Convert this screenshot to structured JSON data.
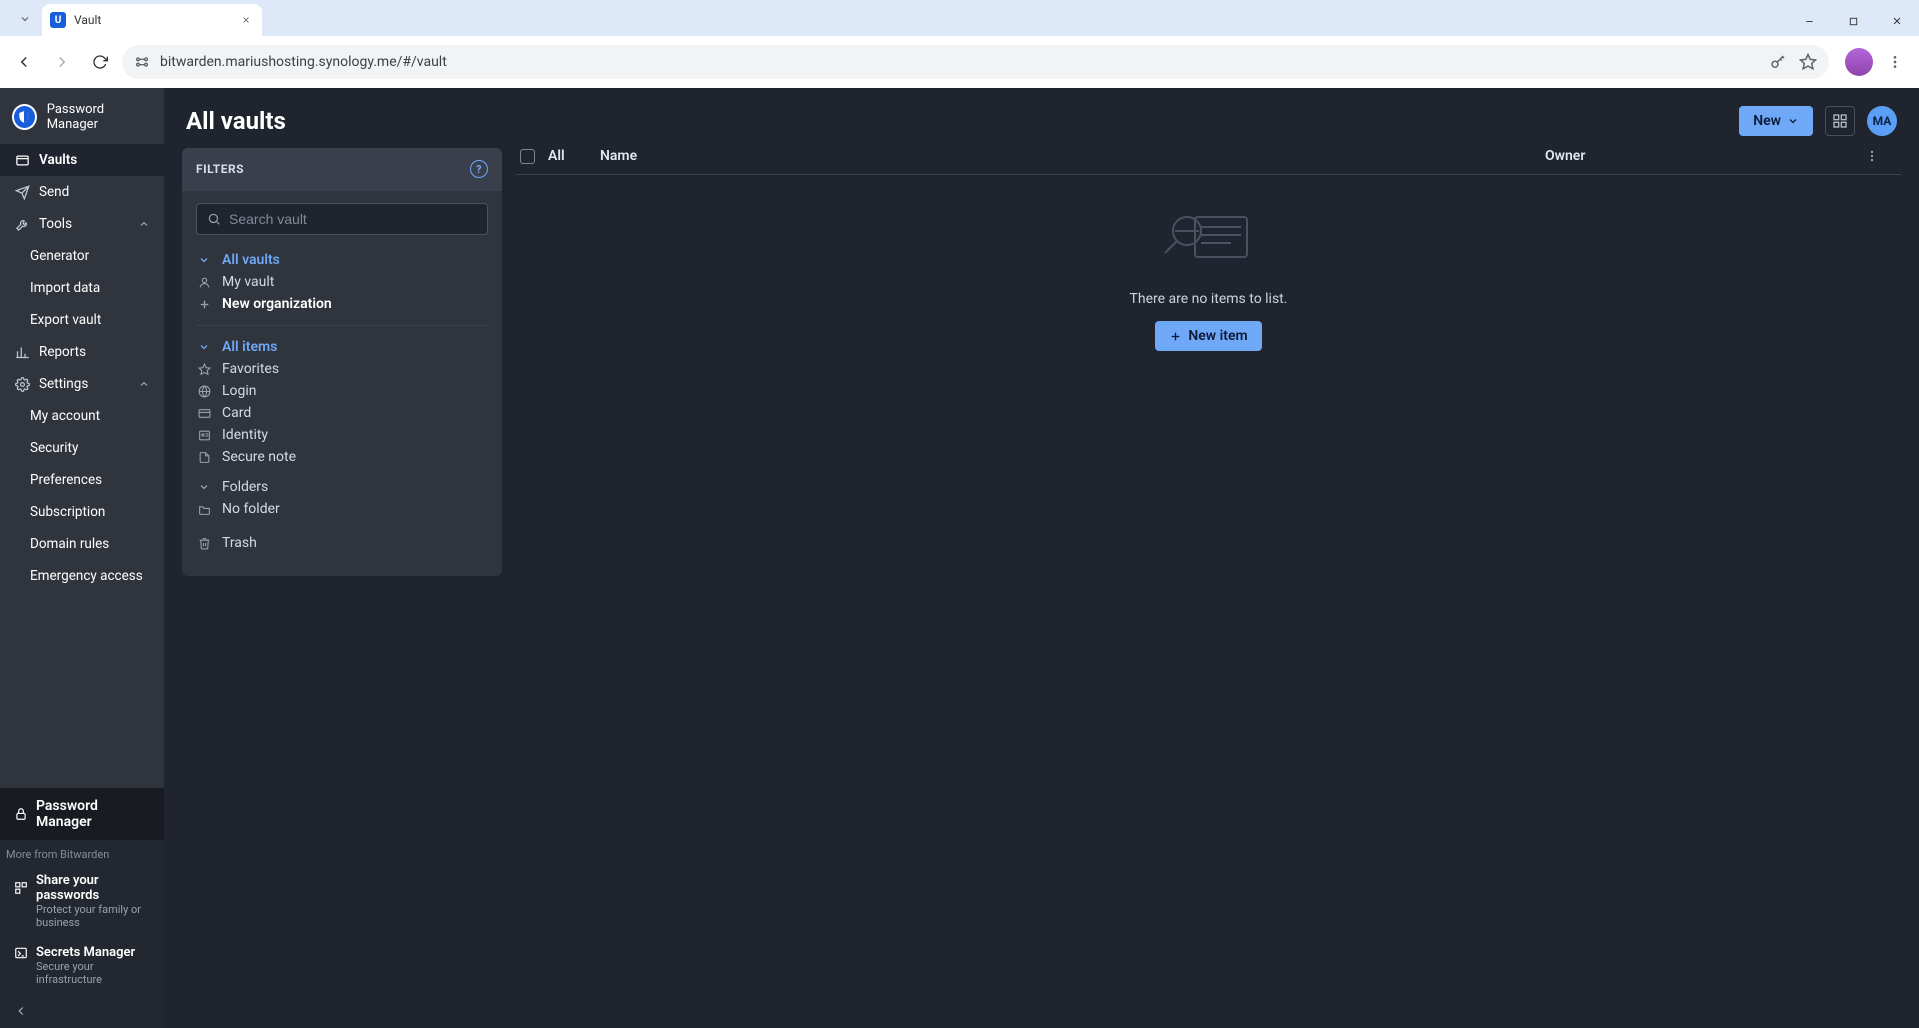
{
  "browser": {
    "tab_title": "Vault",
    "url": "bitwarden.mariushosting.synology.me/#/vault"
  },
  "brand": {
    "name": "Password Manager"
  },
  "sidebar": {
    "items": [
      {
        "label": "Vaults",
        "icon": "vault-icon",
        "active": true
      },
      {
        "label": "Send",
        "icon": "send-icon"
      },
      {
        "label": "Tools",
        "icon": "tools-icon",
        "expandable": true
      },
      {
        "label": "Reports",
        "icon": "reports-icon"
      },
      {
        "label": "Settings",
        "icon": "settings-icon",
        "expandable": true
      }
    ],
    "tools_children": [
      {
        "label": "Generator"
      },
      {
        "label": "Import data"
      },
      {
        "label": "Export vault"
      }
    ],
    "settings_children": [
      {
        "label": "My account"
      },
      {
        "label": "Security"
      },
      {
        "label": "Preferences"
      },
      {
        "label": "Subscription"
      },
      {
        "label": "Domain rules"
      },
      {
        "label": "Emergency access"
      }
    ],
    "bottom": {
      "active_product": "Password Manager",
      "more_label": "More from Bitwarden",
      "products": [
        {
          "title": "Share your passwords",
          "subtitle": "Protect your family or business"
        },
        {
          "title": "Secrets Manager",
          "subtitle": "Secure your infrastructure"
        }
      ]
    }
  },
  "page": {
    "title": "All vaults",
    "new_button": "New",
    "avatar_initials": "MA"
  },
  "filters": {
    "header": "FILTERS",
    "search_placeholder": "Search vault",
    "vaults": {
      "all": "All vaults",
      "my": "My vault",
      "new_org": "New organization"
    },
    "items": {
      "all": "All items",
      "favorites": "Favorites",
      "login": "Login",
      "card": "Card",
      "identity": "Identity",
      "secure_note": "Secure note"
    },
    "folders": {
      "label": "Folders",
      "no_folder": "No folder"
    },
    "trash": "Trash"
  },
  "table": {
    "columns": {
      "all": "All",
      "name": "Name",
      "owner": "Owner"
    },
    "empty_text": "There are no items to list.",
    "new_item_button": "New item"
  },
  "colors": {
    "accent": "#6fa8f7",
    "bg": "#1f242e",
    "panel": "#2f343d"
  }
}
